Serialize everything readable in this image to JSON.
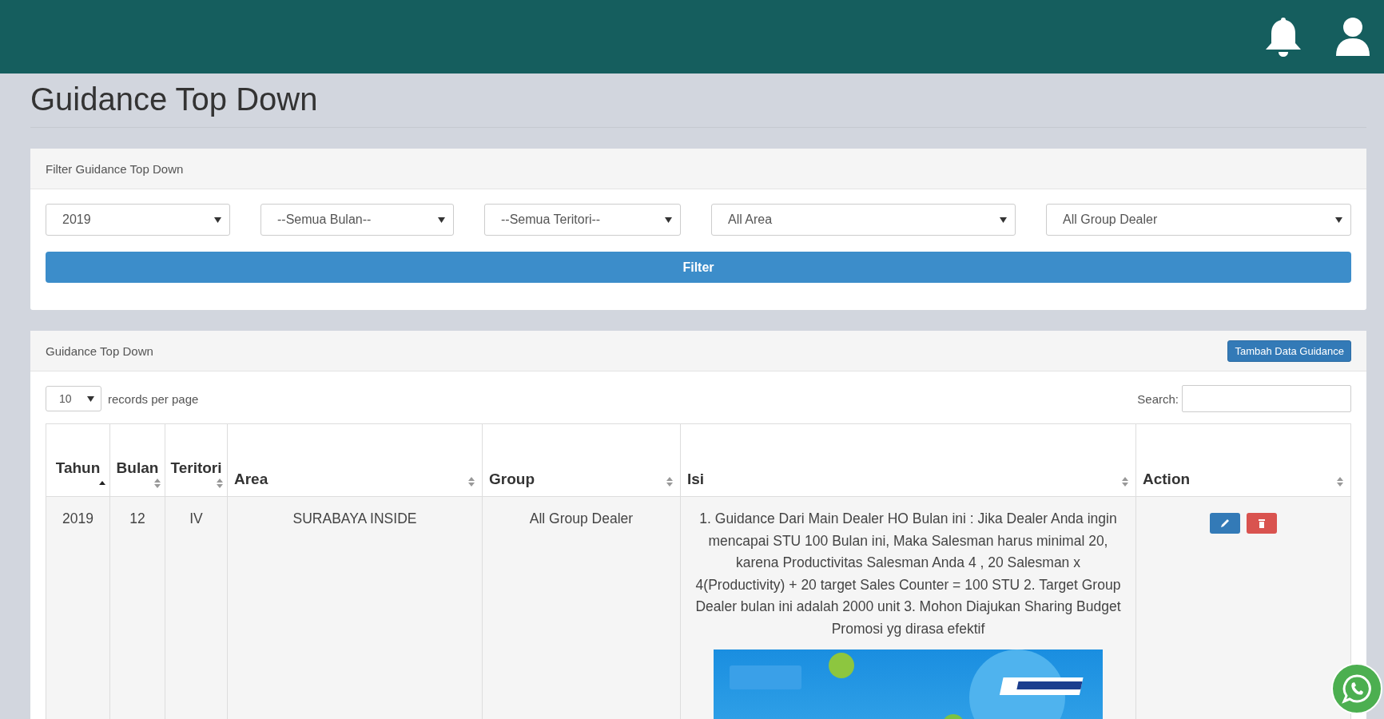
{
  "page_title": "Guidance Top Down",
  "filter_panel": {
    "heading": "Filter Guidance Top Down",
    "selects": [
      {
        "value": "2019"
      },
      {
        "value": "--Semua Bulan--"
      },
      {
        "value": "--Semua Teritori--"
      },
      {
        "value": "All Area"
      },
      {
        "value": "All Group Dealer"
      }
    ],
    "button": "Filter"
  },
  "table_panel": {
    "heading": "Guidance Top Down",
    "add_button": "Tambah Data Guidance",
    "page_size": "10",
    "page_size_label": "records per page",
    "search_label": "Search:",
    "columns": [
      {
        "label": "Tahun",
        "sorted": true
      },
      {
        "label": "Bulan",
        "sorted": false
      },
      {
        "label": "Teritori",
        "sorted": false
      },
      {
        "label": "Area",
        "sorted": false
      },
      {
        "label": "Group",
        "sorted": false
      },
      {
        "label": "Isi",
        "sorted": false
      },
      {
        "label": "Action",
        "sorted": false
      }
    ],
    "rows": [
      {
        "tahun": "2019",
        "bulan": "12",
        "teritori": "IV",
        "area": "SURABAYA INSIDE",
        "group": "All Group Dealer",
        "isi": "1. Guidance Dari Main Dealer HO Bulan ini : Jika Dealer Anda ingin mencapai STU 100 Bulan ini, Maka Salesman harus minimal 20, karena Productivitas Salesman Anda 4 , 20 Salesman x 4(Productivity) + 20 target Sales Counter = 100 STU 2. Target Group Dealer bulan ini adalah 2000 unit 3. Mohon Diajukan Sharing Budget Promosi yg dirasa efektif"
      }
    ]
  }
}
